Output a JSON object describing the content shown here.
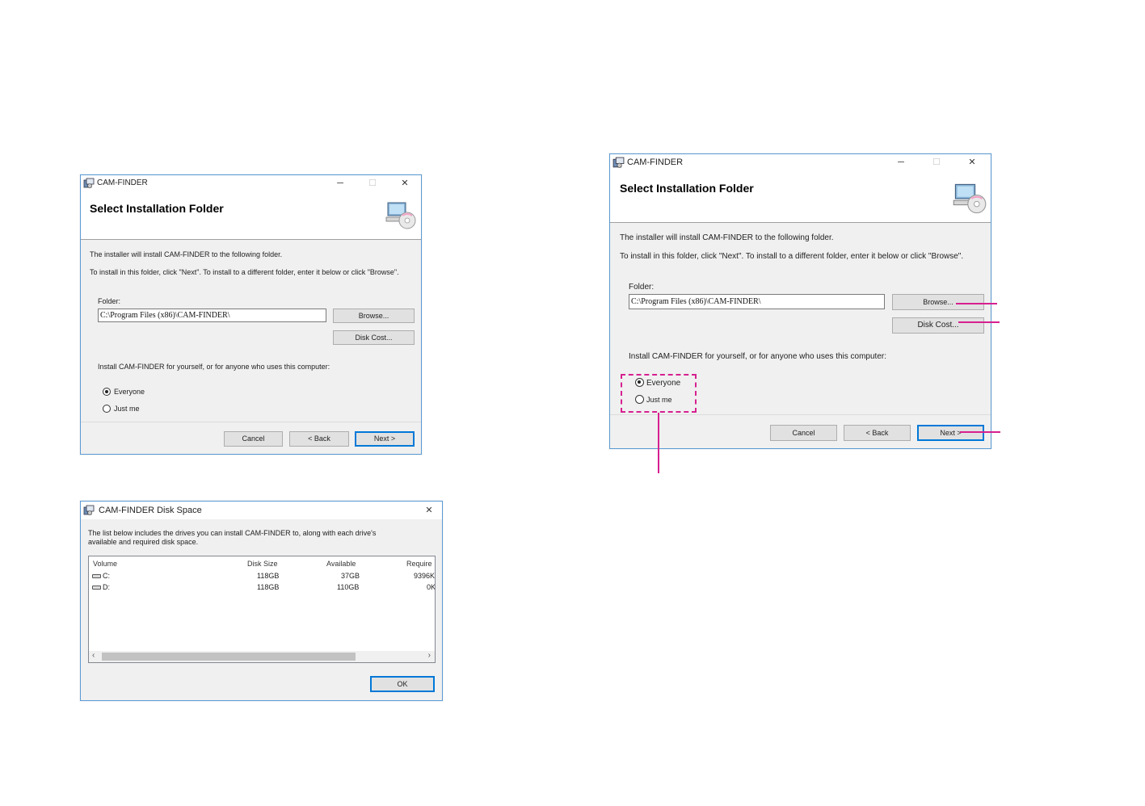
{
  "dialog_a": {
    "title": "CAM-FINDER",
    "heading": "Select Installation Folder",
    "line1": "The installer will install CAM-FINDER to the following folder.",
    "line2": "To install in this folder, click \"Next\". To install to a different folder, enter it below or click \"Browse\".",
    "folder_label": "Folder:",
    "folder_value": "C:\\Program Files (x86)\\CAM-FINDER\\",
    "browse": "Browse...",
    "disk_cost": "Disk Cost...",
    "install_for": "Install CAM-FINDER for yourself, or for anyone who uses this computer:",
    "everyone": "Everyone",
    "just_me": "Just me",
    "cancel": "Cancel",
    "back": "< Back",
    "next": "Next >"
  },
  "dialog_b": {
    "title": "CAM-FINDER",
    "heading": "Select Installation Folder",
    "line1": "The installer will install CAM-FINDER to the following folder.",
    "line2": "To install in this folder, click \"Next\". To install to a different folder, enter it below or click \"Browse\".",
    "folder_label": "Folder:",
    "folder_value": "C:\\Program Files (x86)\\CAM-FINDER\\",
    "browse": "Browse...",
    "disk_cost": "Disk Cost...",
    "install_for": "Install CAM-FINDER for yourself, or for anyone who uses this computer:",
    "everyone": "Everyone",
    "just_me": "Just me",
    "cancel": "Cancel",
    "back": "< Back",
    "next": "Next >"
  },
  "disk_space": {
    "title": "CAM-FINDER Disk Space",
    "desc_line1": "The list below includes the drives you can install CAM-FINDER to, along with each drive's",
    "desc_line2": "available and required disk space.",
    "columns": [
      "Volume",
      "Disk Size",
      "Available",
      "Require"
    ],
    "rows": [
      [
        "C:",
        "118GB",
        "37GB",
        "9396K"
      ],
      [
        "D:",
        "118GB",
        "110GB",
        "0K"
      ]
    ],
    "ok": "OK"
  },
  "colors": {
    "accent": "#0078d7",
    "callout": "#d6208f"
  },
  "icons": [
    "installer-icon",
    "computer-cd-icon",
    "minimize-icon",
    "maximize-icon",
    "close-icon",
    "drive-icon"
  ]
}
